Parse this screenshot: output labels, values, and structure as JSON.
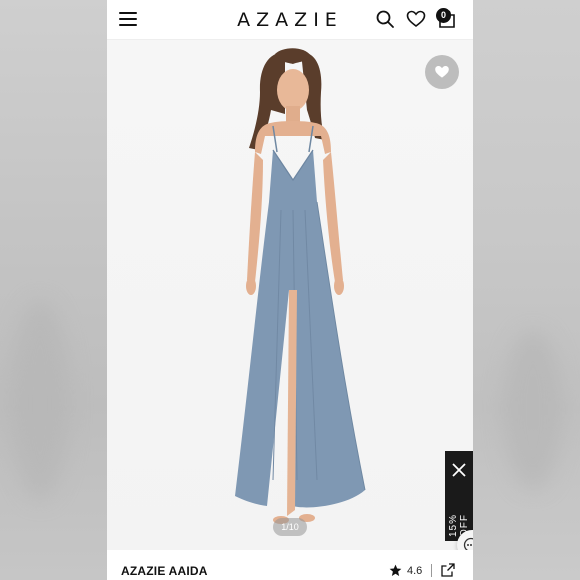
{
  "header": {
    "logo": "AZAZIE",
    "cart_count": "0"
  },
  "gallery": {
    "counter": "1/10",
    "dress_color": "#7f98b3",
    "background": "#f5f5f5"
  },
  "promo": {
    "label": "15% OFF"
  },
  "product": {
    "name": "AZAZIE AAIDA",
    "rating": "4.6"
  },
  "icons": {
    "menu": "menu-icon",
    "search": "search-icon",
    "wishlist": "heart-icon",
    "bag": "shopping-bag-icon",
    "favorite": "heart-icon",
    "close": "close-icon",
    "chat": "chat-icon",
    "star": "star-icon",
    "share": "share-icon"
  }
}
